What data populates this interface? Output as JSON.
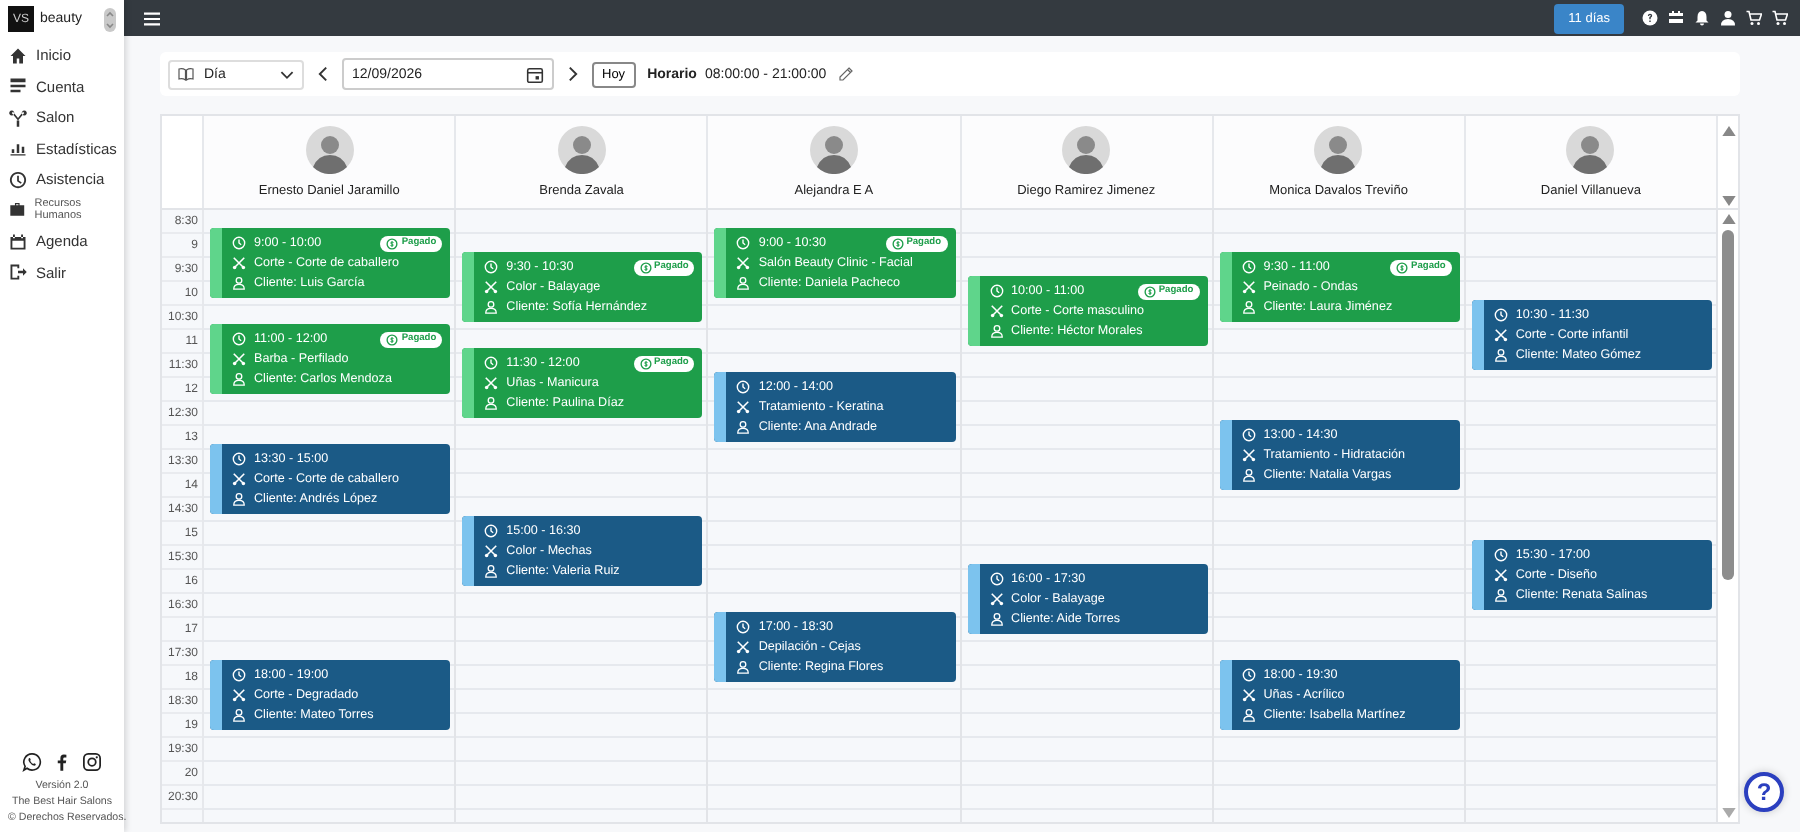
{
  "sidebar": {
    "logo": "VS",
    "brand": "beauty",
    "items": [
      {
        "label": "Inicio"
      },
      {
        "label": "Cuenta"
      },
      {
        "label": "Salon"
      },
      {
        "label": "Estadísticas"
      },
      {
        "label": "Asistencia"
      },
      {
        "label": "Recursos Humanos"
      },
      {
        "label": "Agenda"
      },
      {
        "label": "Salir"
      }
    ],
    "footer": [
      "Versión 2.0",
      "The Best Hair Salons",
      "© Derechos Reservados."
    ]
  },
  "top_bar": {
    "days_badge": "11 días"
  },
  "toolbar": {
    "view": "Día",
    "date": "12/09/2026",
    "today": "Hoy",
    "schedule_label": "Horario",
    "schedule": "08:00:00 - 21:00:00"
  },
  "calendar": {
    "times": [
      "8:30",
      "9",
      "9:30",
      "10",
      "10:30",
      "11",
      "11:30",
      "12",
      "12:30",
      "13",
      "13:30",
      "14",
      "14:30",
      "15",
      "15:30",
      "16",
      "16:30",
      "17",
      "17:30",
      "18",
      "18:30",
      "19",
      "19:30",
      "20",
      "20:30"
    ],
    "staff": [
      {
        "name": "Ernesto Daniel Jaramillo",
        "events": [
          {
            "time": "9:00 - 10:00",
            "service": "Corte - Corte de caballero",
            "client": "Cliente: Luis García",
            "paid": true,
            "badge": "Pagado"
          },
          {
            "time": "11:00 - 12:00",
            "service": "Barba - Perfilado",
            "client": "Cliente: Carlos Mendoza",
            "paid": true,
            "badge": "Pagado"
          },
          {
            "time": "13:30 - 15:00",
            "service": "Corte - Corte de caballero",
            "client": "Cliente: Andrés López",
            "paid": false
          },
          {
            "time": "18:00 - 19:00",
            "service": "Corte - Degradado",
            "client": "Cliente: Mateo Torres",
            "paid": false
          }
        ]
      },
      {
        "name": "Brenda Zavala",
        "events": [
          {
            "time": "9:30 - 10:30",
            "service": "Color - Balayage",
            "client": "Cliente: Sofía Hernández",
            "paid": true,
            "badge": "Pagado"
          },
          {
            "time": "11:30 - 12:00",
            "service": "Uñas - Manicura",
            "client": "Cliente: Paulina Díaz",
            "paid": true,
            "badge": "Pagado"
          },
          {
            "time": "15:00 - 16:30",
            "service": "Color - Mechas",
            "client": "Cliente: Valeria Ruiz",
            "paid": false
          }
        ]
      },
      {
        "name": "Alejandra E A",
        "events": [
          {
            "time": "9:00 - 10:30",
            "service": "Salón Beauty Clinic - Facial",
            "client": "Cliente: Daniela Pacheco",
            "paid": true,
            "badge": "Pagado"
          },
          {
            "time": "12:00 - 14:00",
            "service": "Tratamiento - Keratina",
            "client": "Cliente: Ana Andrade",
            "paid": false
          },
          {
            "time": "17:00 - 18:30",
            "service": "Depilación - Cejas",
            "client": "Cliente: Regina Flores",
            "paid": false
          }
        ]
      },
      {
        "name": "Diego Ramirez Jimenez",
        "events": [
          {
            "time": "10:00 - 11:00",
            "service": "Corte - Corte masculino",
            "client": "Cliente: Héctor Morales",
            "paid": true,
            "badge": "Pagado"
          },
          {
            "time": "16:00 - 17:30",
            "service": "Color - Balayage",
            "client": "Cliente: Aide Torres",
            "paid": false
          }
        ]
      },
      {
        "name": "Monica Davalos Treviño",
        "events": [
          {
            "time": "9:30 - 11:00",
            "service": "Peinado - Ondas",
            "client": "Cliente: Laura Jiménez",
            "paid": true,
            "badge": "Pagado"
          },
          {
            "time": "13:00 - 14:30",
            "service": "Tratamiento - Hidratación",
            "client": "Cliente: Natalia Vargas",
            "paid": false
          },
          {
            "time": "18:00 - 19:30",
            "service": "Uñas - Acrílico",
            "client": "Cliente: Isabella Martínez",
            "paid": false
          }
        ]
      },
      {
        "name": "Daniel Villanueva",
        "events": [
          {
            "time": "10:30 - 11:30",
            "service": "Corte - Corte infantil",
            "client": "Cliente: Mateo Gómez",
            "paid": false
          },
          {
            "time": "15:30 - 17:00",
            "service": "Corte - Diseño",
            "client": "Cliente: Renata Salinas",
            "paid": false
          }
        ]
      }
    ]
  },
  "help": "?"
}
